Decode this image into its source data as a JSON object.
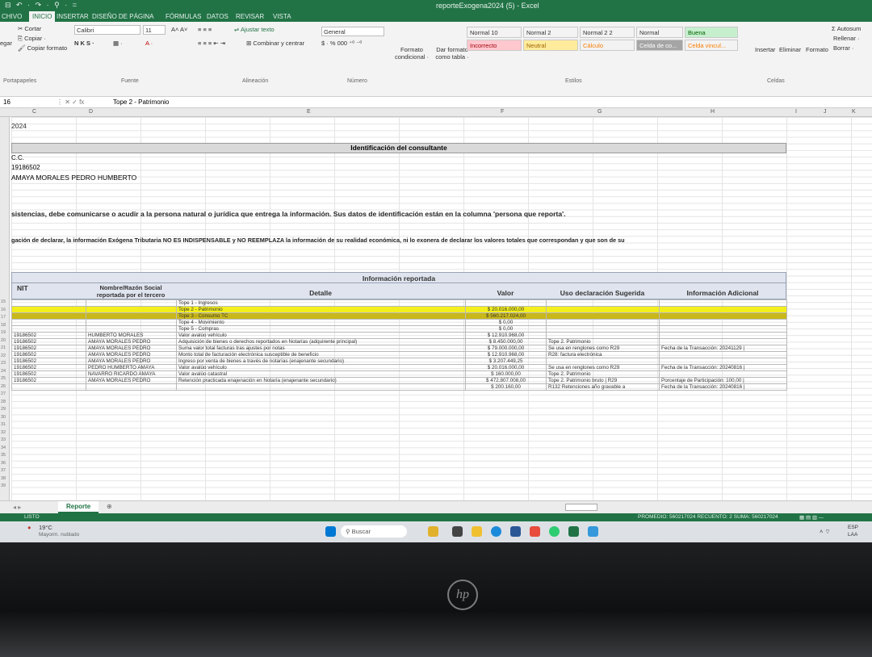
{
  "window": {
    "doc_title": "reporteExogena2024 (5) - Excel",
    "quick_access": "⊟ ↶ · ↷ · ⚲ · ="
  },
  "ribbon_tabs": [
    "CHIVO",
    "INICIO",
    "INSERTAR",
    "DISEÑO DE PÁGINA",
    "FÓRMULAS",
    "DATOS",
    "REVISAR",
    "VISTA"
  ],
  "ribbon": {
    "cut": "Cortar",
    "copy": "Copiar ·",
    "format_painter": "Copiar formato",
    "paste": "egar",
    "font_name": "Calibri",
    "font_size": "11",
    "wrap_text": "Ajustar texto",
    "merge_center": "Combinar y centrar",
    "number_format": "General",
    "conditional": "Formato condicional ·",
    "as_table": "Dar formato como tabla ·",
    "styles": [
      {
        "label": "Normal 10",
        "bg": "#ffffff",
        "fg": "#333333"
      },
      {
        "label": "Normal 2",
        "bg": "#ffffff",
        "fg": "#333333"
      },
      {
        "label": "Normal 2 2",
        "bg": "#ffffff",
        "fg": "#333333"
      },
      {
        "label": "Normal",
        "bg": "#ffffff",
        "fg": "#333333"
      },
      {
        "label": "Buena",
        "bg": "#c6efce",
        "fg": "#006100"
      },
      {
        "label": "Incorrecto",
        "bg": "#ffc7ce",
        "fg": "#9c0006"
      },
      {
        "label": "Neutral",
        "bg": "#ffeb9c",
        "fg": "#9c6500"
      },
      {
        "label": "Cálculo",
        "bg": "#f2f2f2",
        "fg": "#fa7d00"
      },
      {
        "label": "Celda de co...",
        "bg": "#a5a5a5",
        "fg": "#ffffff"
      },
      {
        "label": "Celda vincul...",
        "bg": "#ffffff",
        "fg": "#fa7d00"
      }
    ],
    "insert": "Insertar",
    "delete": "Eliminar",
    "format": "Formato",
    "autosum": "Σ Autosum",
    "fill": "Rellenar ·",
    "clear": "Borrar ·",
    "groups": {
      "clipboard": "Portapapeles",
      "font": "Fuente",
      "alignment": "Alineación",
      "number": "Número",
      "styles": "Estilos",
      "cells": "Celdas"
    }
  },
  "formula_bar": {
    "name_box": "16",
    "content": "Tope 2 - Patrimonio"
  },
  "col_headers": [
    "C",
    "D",
    "E",
    "F",
    "G",
    "H",
    "I",
    "J",
    "K"
  ],
  "sheet": {
    "year": "2024",
    "section_title": "Identificación del consultante",
    "id_type": "C.C.",
    "id_number": "19186502",
    "name": "AMAYA MORALES PEDRO HUMBERTO",
    "notice1": "sistencias, debe comunicarse o acudir a la persona natural o jurídica que entrega la información. Sus datos de identificación están en la columna 'persona que reporta'.",
    "notice2": "gación de declarar, la información Exógena Tributaria NO ES INDISPENSABLE y NO REEMPLAZA la información de su realidad económica, ni lo exonera de declarar los valores totales que correspondan y que son de su",
    "table_title": "Información reportada",
    "headers": {
      "nit": "NIT",
      "nombre": "Nombre/Razón Social reportada por el tercero",
      "detalle": "Detalle",
      "valor": "Valor",
      "uso": "Uso declaración Sugerida",
      "info": "Información Adicional"
    },
    "row_numbers": [
      "15",
      "16",
      "17",
      "18",
      "19",
      "20",
      "21",
      "22",
      "23",
      "24",
      "25",
      "26",
      "27",
      "28",
      "29",
      "30",
      "31",
      "32",
      "33",
      "34",
      "35",
      "36",
      "37",
      "38",
      "39"
    ],
    "rows": [
      {
        "nit": "",
        "nombre": "",
        "detalle": "Tope 1 - Ingresos",
        "valor": "",
        "uso": "",
        "info": ""
      },
      {
        "nit": "",
        "nombre": "",
        "detalle": "Tope 2 - Patrimonio",
        "valor": "$ 20.016.000,00",
        "uso": "",
        "info": "",
        "style": "hl"
      },
      {
        "nit": "",
        "nombre": "",
        "detalle": "Tope 3 - Consumo TC",
        "valor": "$ 560.217.024,00",
        "uso": "",
        "info": "",
        "style": "hl2"
      },
      {
        "nit": "",
        "nombre": "",
        "detalle": "Tope 4 - Movimiento",
        "valor": "$ 0,00",
        "uso": "",
        "info": ""
      },
      {
        "nit": "",
        "nombre": "",
        "detalle": "Tope 5 - Compras",
        "valor": "$ 0,00",
        "uso": "",
        "info": ""
      },
      {
        "nit": "19186502",
        "nombre": "HUMBERTO MORALES",
        "detalle": "Valor avalúo vehículo",
        "valor": "$ 12.910.968,00",
        "uso": "",
        "info": ""
      },
      {
        "nit": "19186502",
        "nombre": "AMAYA MORALES PEDRO",
        "detalle": "Adquisición de bienes o derechos reportados en Notarías (adquirente principal)",
        "valor": "$ 8.450.000,00",
        "uso": "Tope 2. Patrimonio",
        "info": ""
      },
      {
        "nit": "19186502",
        "nombre": "AMAYA MORALES PEDRO",
        "detalle": "Suma valor total facturas tras ajustes por notas",
        "valor": "$ 79.000.000,00",
        "uso": "Se usa en renglones como R29",
        "info": "Fecha de la Transacción: 20241129 |"
      },
      {
        "nit": "19186502",
        "nombre": "AMAYA MORALES PEDRO",
        "detalle": "Monto total de facturación electrónica susceptible de beneficio",
        "valor": "$ 12.910.968,00",
        "uso": "R28: factura electrónica",
        "info": ""
      },
      {
        "nit": "19186502",
        "nombre": "AMAYA MORALES PEDRO",
        "detalle": "Ingreso por venta de bienes a través de notarías (enajenante secundario)",
        "valor": "$ 3.207.449,25",
        "uso": "",
        "info": ""
      },
      {
        "nit": "19186502",
        "nombre": "PEDRO HUMBERTO AMAYA",
        "detalle": "Valor avalúo vehículo",
        "valor": "$ 20.016.000,00",
        "uso": "Se usa en renglones como R29",
        "info": "Fecha de la Transacción: 20240816 |"
      },
      {
        "nit": "19186502",
        "nombre": "NAVARRO RICARDO AMAYA",
        "detalle": "Valor avalúo catastral",
        "valor": "$ 160.000,00",
        "uso": "Tope 2. Patrimonio",
        "info": ""
      },
      {
        "nit": "19186502",
        "nombre": "AMAYA MORALES PEDRO",
        "detalle": "Retención practicada enajenación en Notaría (enajenante secundario)",
        "valor": "$ 472.807.008,00",
        "uso": "Tope 2. Patrimonio bruto | R29",
        "info": "Porcentaje de Participación: 100,00 |"
      },
      {
        "nit": "",
        "nombre": "",
        "detalle": "",
        "valor": "$ 200.160,00",
        "uso": "R132 Retenciones año gravable a",
        "info": "Fecha de la Transacción: 20240816 |"
      }
    ]
  },
  "sheet_tabs": {
    "active": "Reporte",
    "add": "⊕"
  },
  "status": {
    "mode": "LISTO",
    "summary": "PROMEDIO: 560217024   RECUENTO: 2   SUMA: 560217024"
  },
  "taskbar": {
    "weather_temp": "19°C",
    "weather_desc": "Mayorm. nublado",
    "search_placeholder": "Buscar",
    "lang": "ESP",
    "lang2": "LAA"
  },
  "brand": "hp"
}
